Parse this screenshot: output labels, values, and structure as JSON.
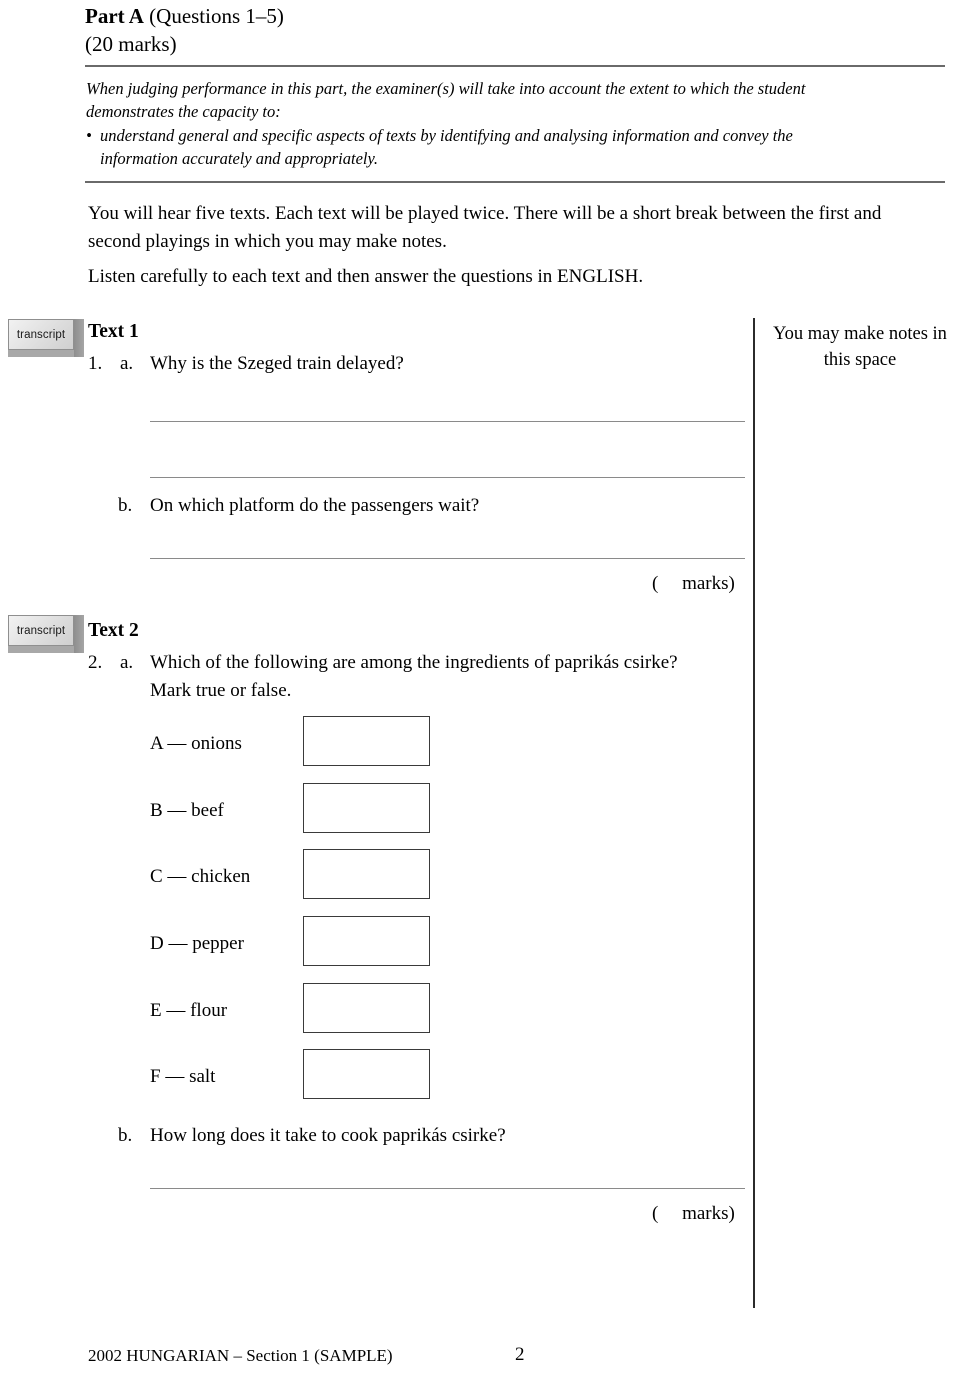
{
  "header": {
    "part_title_bold": "Part A",
    "part_title_rest": " (Questions 1–5)",
    "marks": "(20 marks)"
  },
  "criteria": {
    "intro_line1": "When judging performance in this part, the examiner(s) will take into account the extent to which the student",
    "intro_line2": "demonstrates the capacity to:",
    "bullet_dot": "•",
    "bullet_line1": "understand general and specific aspects of texts by identifying and analysing information and convey the",
    "bullet_line2": "information accurately and appropriately."
  },
  "instructions": {
    "paragraph_1_line1": "You will hear five texts. Each text will be played twice. There will be a short break between the first and",
    "paragraph_1_line2": "second playings in which you may make notes.",
    "paragraph_2": "Listen carefully to each text and then answer the questions in ENGLISH."
  },
  "notes_column": {
    "line1": "You may make notes in",
    "line2": "this space"
  },
  "transcript_badge_label": "transcript",
  "text1": {
    "heading": "Text 1",
    "question_number": "1.",
    "part_a_letter": "a.",
    "part_a_text": "Why is the Szeged train delayed?",
    "part_b_letter": "b.",
    "part_b_text": "On which platform do the passengers wait?",
    "marks_label": "(     marks)"
  },
  "text2": {
    "heading": "Text 2",
    "question_number": "2.",
    "part_a_letter": "a.",
    "part_a_text_line1": "Which of the following are among the ingredients of paprikás csirke?",
    "part_a_text_line2": "Mark true or false.",
    "options": [
      {
        "label": "A — onions"
      },
      {
        "label": "B — beef"
      },
      {
        "label": "C — chicken"
      },
      {
        "label": "D — pepper"
      },
      {
        "label": "E — flour"
      },
      {
        "label": "F — salt"
      }
    ],
    "part_b_letter": "b.",
    "part_b_text": "How long does it take to cook paprikás csirke?",
    "marks_label": "(     marks)"
  },
  "footer": {
    "reference": "2002 HUNGARIAN – Section 1 (SAMPLE)",
    "page_number": "2"
  },
  "colors": {
    "rule_gray": "#6a6a6a",
    "answer_line_gray": "#8a8a8a",
    "divider_black": "#2b2b2b",
    "box_border": "#3a3a3a"
  }
}
